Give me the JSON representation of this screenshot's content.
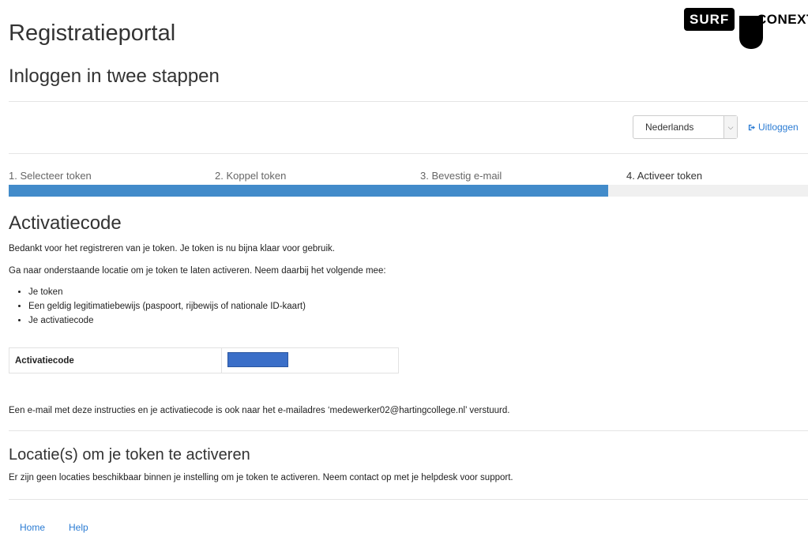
{
  "header": {
    "title": "Registratieportal",
    "subtitle": "Inloggen in twee stappen",
    "logo": {
      "left": "SURF",
      "right": "CONEXT"
    }
  },
  "toolbar": {
    "language_selected": "Nederlands",
    "logout_label": "Uitloggen"
  },
  "steps": {
    "items": [
      "1. Selecteer token",
      "2. Koppel token",
      "3. Bevestig e-mail",
      "4. Activeer token"
    ],
    "progress_fraction": 0.75
  },
  "activation": {
    "heading": "Activatiecode",
    "para1": "Bedankt voor het registreren van je token. Je token is nu bijna klaar voor gebruik.",
    "para2": "Ga naar onderstaande locatie om je token te laten activeren. Neem daarbij het volgende mee:",
    "bring_items": [
      "Je token",
      "Een geldig legitimatiebewijs (paspoort, rijbewijs of nationale ID-kaart)",
      "Je activatiecode"
    ],
    "code_label": "Activatiecode",
    "email_note": "Een e-mail met deze instructies en je activatiecode is ook naar het e-mailadres ‘medewerker02@hartingcollege.nl’ verstuurd."
  },
  "locations": {
    "heading": "Locatie(s) om je token te activeren",
    "note": "Er zijn geen locaties beschikbaar binnen je instelling om je token te activeren. Neem contact op met je helpdesk voor support."
  },
  "footer": {
    "home_label": "Home",
    "help_label": "Help"
  },
  "colors": {
    "accent": "#428bca",
    "link": "#2a7bd3",
    "redaction": "#3b6fc8"
  }
}
